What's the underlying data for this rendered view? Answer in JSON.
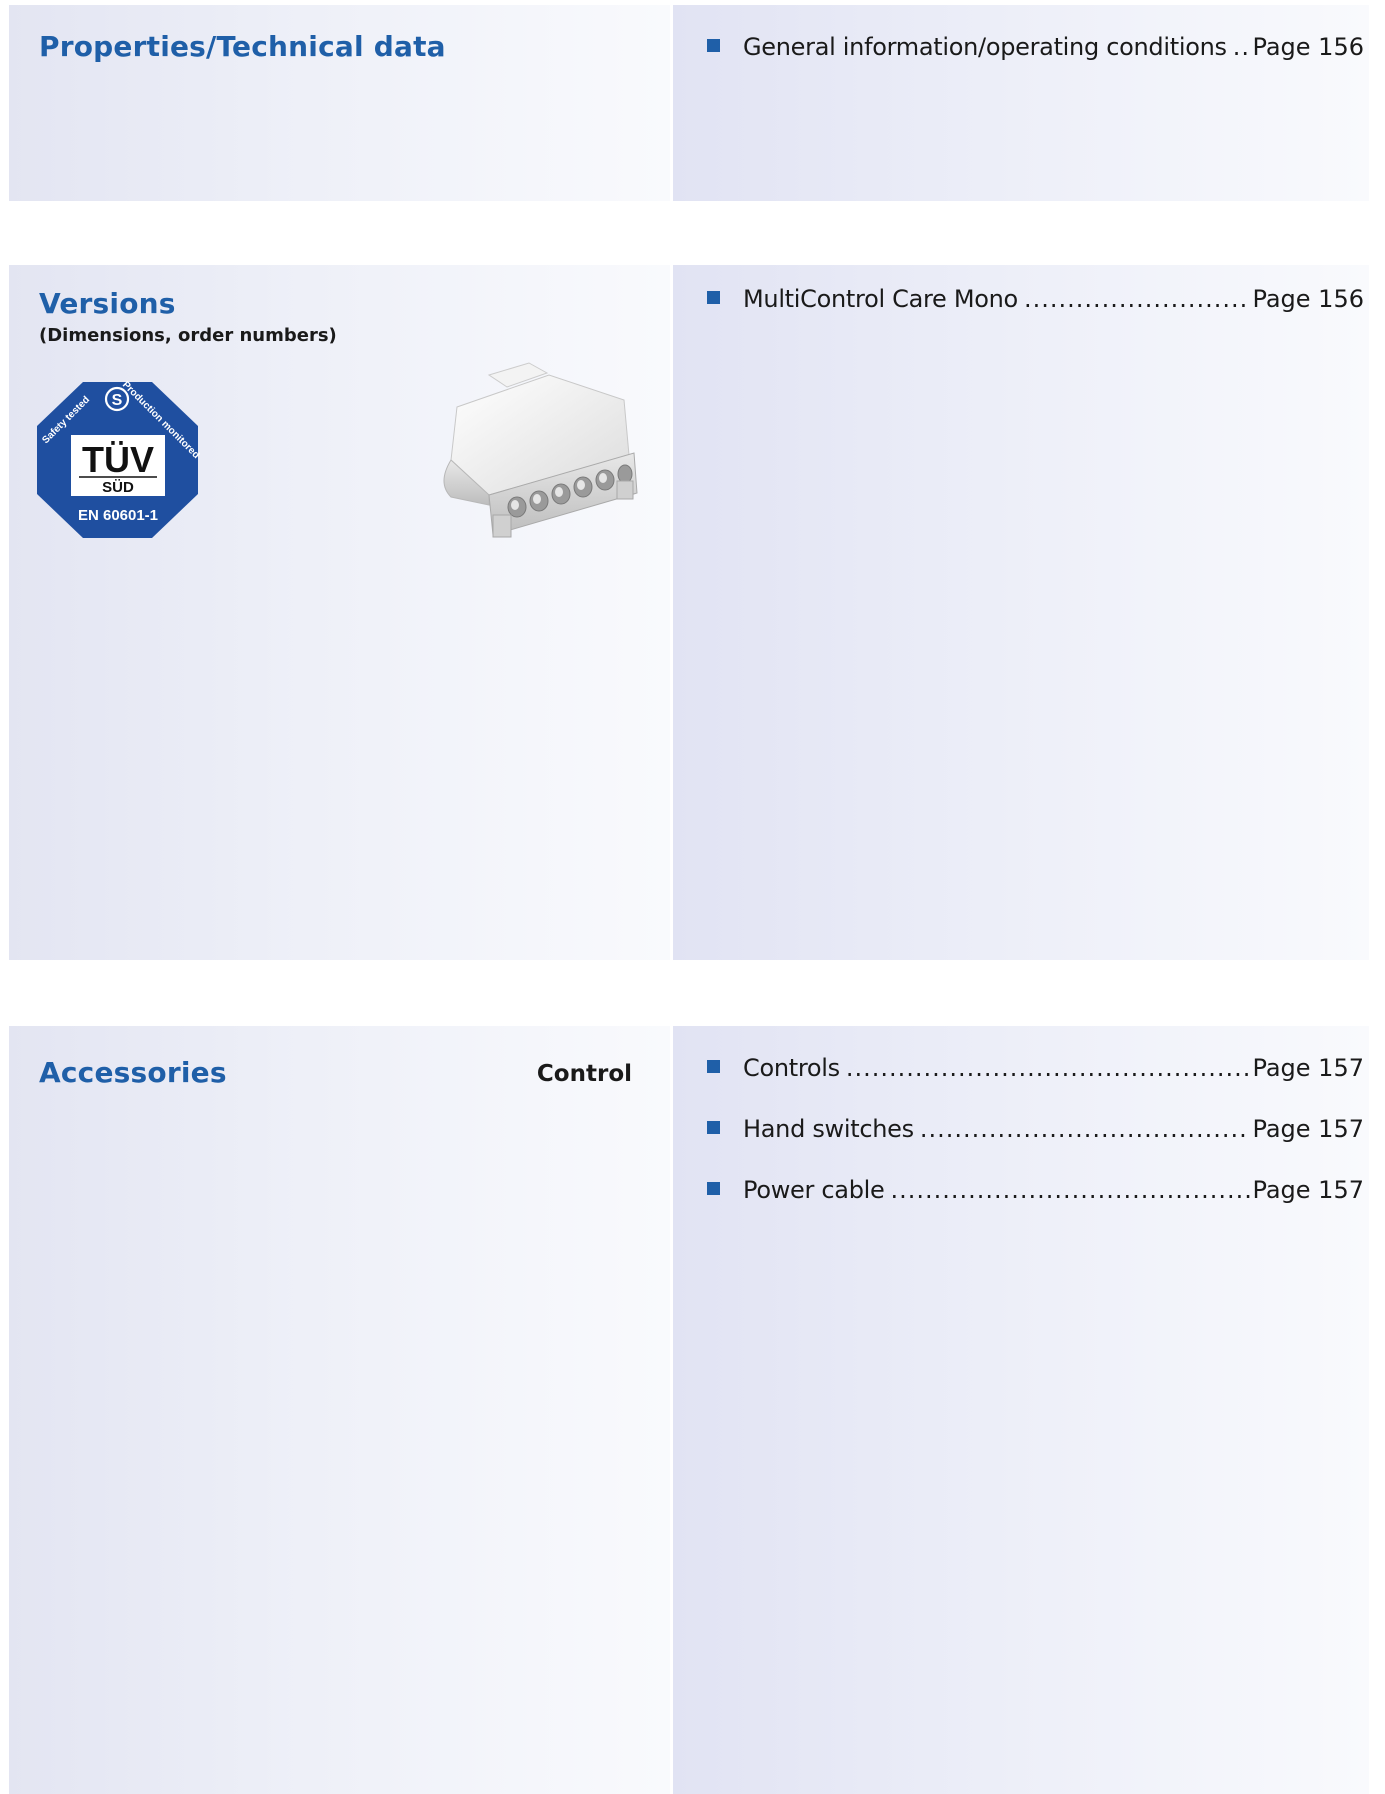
{
  "sections": {
    "properties": {
      "title": "Properties/Technical data",
      "entries": [
        {
          "label": "General information/operating conditions",
          "page": "Page 156"
        }
      ]
    },
    "versions": {
      "title": "Versions",
      "subtitle": "(Dimensions, order numbers)",
      "badge": {
        "left_text": "Safety tested",
        "right_text": "Production monitored",
        "brand": "TÜV",
        "brand_sub": "SÜD",
        "standard": "EN 60601-1",
        "color": "#1f4fa0"
      },
      "entries": [
        {
          "label": "MultiControl Care Mono",
          "page": "Page 156"
        }
      ]
    },
    "accessories": {
      "title": "Accessories",
      "side_label": "Control",
      "entries": [
        {
          "label": "Controls",
          "page": "Page 157"
        },
        {
          "label": "Hand switches",
          "page": "Page 157"
        },
        {
          "label": "Power cable",
          "page": "Page 157"
        }
      ]
    }
  },
  "colors": {
    "accent": "#1f5fa8",
    "panel": "#e3e5f2"
  }
}
